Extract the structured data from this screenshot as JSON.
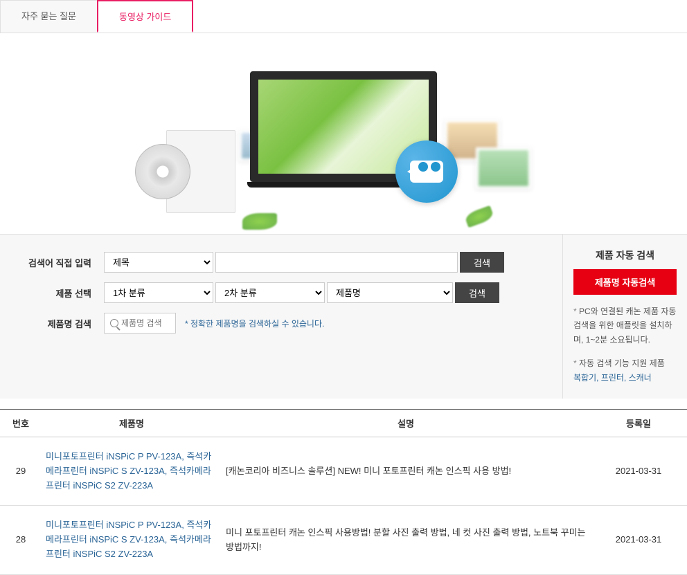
{
  "tabs": {
    "faq": "자주 묻는 질문",
    "video": "동영상 가이드"
  },
  "search": {
    "keywordLabel": "검색어 직접 입력",
    "productSelectLabel": "제품 선택",
    "productNameLabel": "제품명 검색",
    "titleOption": "제목",
    "cat1Option": "1차 분류",
    "cat2Option": "2차 분류",
    "prodOption": "제품명",
    "searchBtn": "검색",
    "nameInputPlaceholder": "제품명 검색",
    "hintText": "* 정확한 제품명을 검색하실 수 있습니다."
  },
  "auto": {
    "title": "제품 자동 검색",
    "btn": "제품명 자동검색",
    "note1": "PC와 연결된 캐논 제품 자동 검색을 위한 애플릿을 설치하며, 1~2분 소요됩니다.",
    "note2": "자동 검색 기능 지원 제품",
    "note2link": "복합기, 프린터, 스캐너"
  },
  "table": {
    "headers": {
      "no": "번호",
      "product": "제품명",
      "desc": "설명",
      "date": "등록일"
    },
    "rows": [
      {
        "no": "29",
        "product": "미니포토프린터 iNSPiC P PV-123A, 즉석카메라프린터 iNSPiC S ZV-123A, 즉석카메라프린터 iNSPiC S2 ZV-223A",
        "desc": "[캐논코리아 비즈니스 솔루션] NEW! 미니 포토프린터 캐논 인스픽 사용 방법!",
        "date": "2021-03-31"
      },
      {
        "no": "28",
        "product": "미니포토프린터 iNSPiC P PV-123A, 즉석카메라프린터 iNSPiC S ZV-123A, 즉석카메라프린터 iNSPiC S2 ZV-223A",
        "desc": "미니 포토프린터 캐논 인스픽 사용방법! 분할 사진 출력 방법, 네 컷 사진 출력 방법, 노트북 꾸미는 방법까지!",
        "date": "2021-03-31"
      }
    ]
  }
}
